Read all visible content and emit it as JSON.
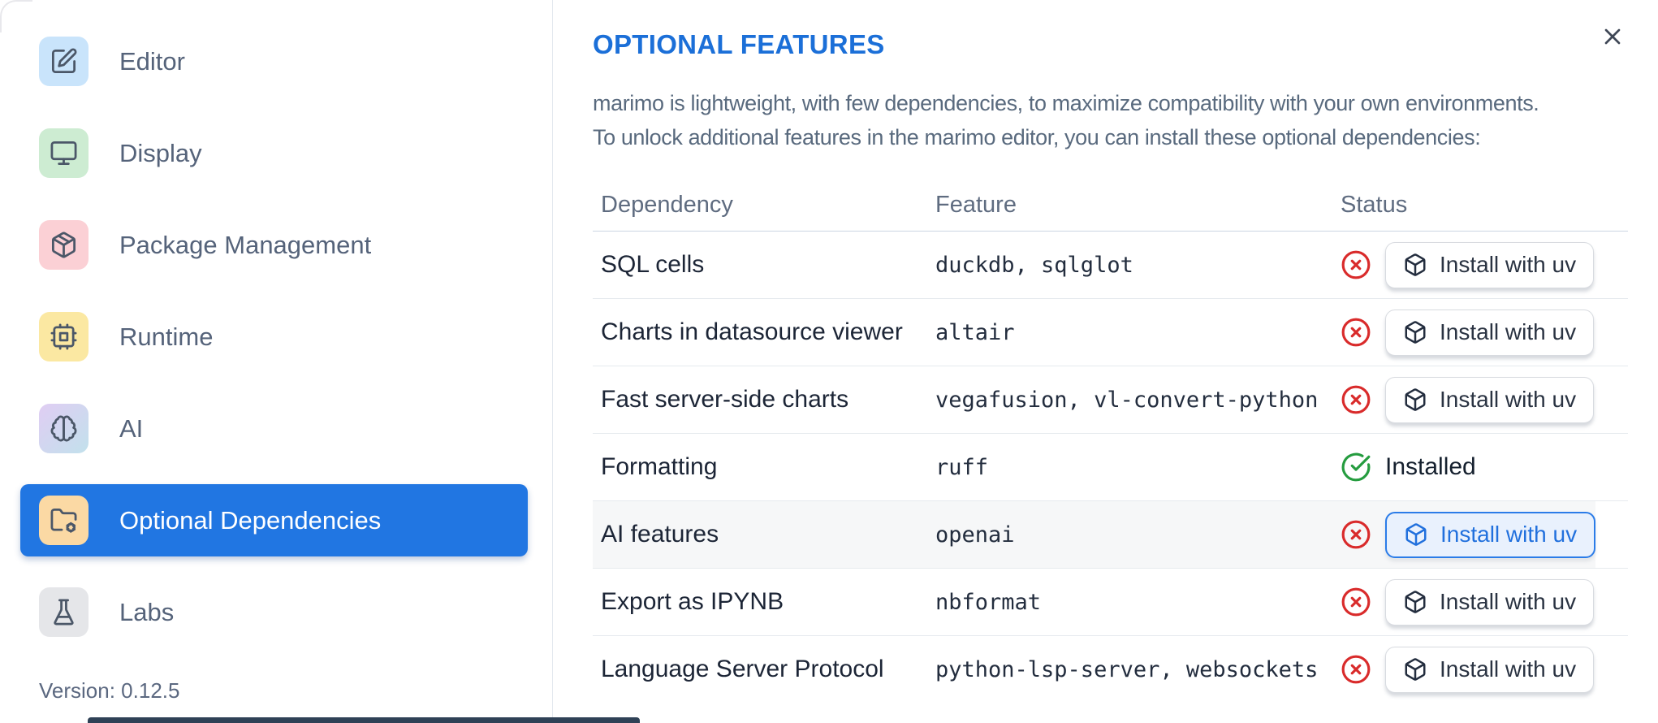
{
  "sidebar": {
    "items": [
      {
        "label": "Editor",
        "icon": "square-pen",
        "icon_bg": "#c9e4fb"
      },
      {
        "label": "Display",
        "icon": "monitor",
        "icon_bg": "#cdecd2"
      },
      {
        "label": "Package Management",
        "icon": "package",
        "icon_bg": "#fbd0d5"
      },
      {
        "label": "Runtime",
        "icon": "cpu",
        "icon_bg": "#fbe8a2"
      },
      {
        "label": "AI",
        "icon": "brain",
        "icon_bg": "linear-gradient(135deg,#e0cdf3 0%,#c2e1ec 100%)"
      },
      {
        "label": "Optional Dependencies",
        "icon": "folder-cog",
        "icon_bg": "#fbd9a4",
        "selected": true
      },
      {
        "label": "Labs",
        "icon": "flask-conical",
        "icon_bg": "#e5e6e9"
      }
    ],
    "version_label": "Version: 0.12.5"
  },
  "panel": {
    "title": "OPTIONAL FEATURES",
    "description_lines": [
      "marimo is lightweight, with few dependencies, to maximize compatibility with your own environments.",
      "To unlock additional features in the marimo editor, you can install these optional dependencies:"
    ]
  },
  "table": {
    "headers": [
      "Dependency",
      "Feature",
      "Status"
    ],
    "install_button_label": "Install with uv",
    "installed_label": "Installed",
    "rows": [
      {
        "dependency": "SQL cells",
        "feature": "duckdb, sqlglot",
        "installed": false
      },
      {
        "dependency": "Charts in datasource viewer",
        "feature": "altair",
        "installed": false
      },
      {
        "dependency": "Fast server-side charts",
        "feature": "vegafusion, vl-convert-python",
        "installed": false
      },
      {
        "dependency": "Formatting",
        "feature": "ruff",
        "installed": true
      },
      {
        "dependency": "AI features",
        "feature": "openai",
        "installed": false,
        "highlighted": true,
        "button_style": "primary"
      },
      {
        "dependency": "Export as IPYNB",
        "feature": "nbformat",
        "installed": false
      },
      {
        "dependency": "Language Server Protocol",
        "feature": "python-lsp-server, websockets",
        "installed": false
      }
    ]
  },
  "colors": {
    "accent_blue": "#2176e2",
    "title_blue": "#1b6fd8",
    "status_error": "#d92b2b",
    "status_success": "#259c3f"
  }
}
